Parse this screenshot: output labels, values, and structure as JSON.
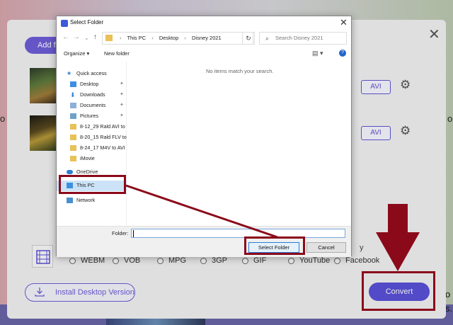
{
  "background": {
    "left_side_text": "o",
    "right_side_text": "o",
    "right_bottom_text_1": "o",
    "right_bottom_text_2": "s."
  },
  "panel": {
    "add_button_label": "Add f",
    "files": [
      {
        "format": "AVI"
      },
      {
        "format": "AVI"
      }
    ],
    "partial_label": "y",
    "formats": [
      "WEBM",
      "VOB",
      "MPG",
      "3GP",
      "GIF",
      "YouTube",
      "Facebook"
    ],
    "install_label": "Install Desktop Version",
    "convert_label": "Convert"
  },
  "dialog": {
    "title": "Select Folder",
    "breadcrumb": [
      "This PC",
      "Desktop",
      "Disney 2021"
    ],
    "search_placeholder": "Search Disney 2021",
    "organize_label": "Organize ▾",
    "new_folder_label": "New folder",
    "empty_message": "No items match your search.",
    "nav_items": [
      {
        "label": "Quick access",
        "icon": "star-icon"
      },
      {
        "label": "Desktop",
        "icon": "desktop-icon",
        "pinned": true
      },
      {
        "label": "Downloads",
        "icon": "download-icon",
        "pinned": true
      },
      {
        "label": "Documents",
        "icon": "document-icon",
        "pinned": true
      },
      {
        "label": "Pictures",
        "icon": "pictures-icon",
        "pinned": true
      },
      {
        "label": "8-12_29 Rald AVI to",
        "icon": "folder-icon"
      },
      {
        "label": "8-20_15 Rald FLV to",
        "icon": "folder-icon"
      },
      {
        "label": "8-24_17 M4V to AVI",
        "icon": "folder-icon"
      },
      {
        "label": "iMovie",
        "icon": "folder-icon"
      },
      {
        "label": "OneDrive",
        "icon": "cloud-icon"
      },
      {
        "label": "This PC",
        "icon": "computer-icon"
      },
      {
        "label": "Network",
        "icon": "network-icon"
      }
    ],
    "folder_label": "Folder:",
    "folder_value": "",
    "select_folder_label": "Select Folder",
    "cancel_label": "Cancel"
  },
  "colors": {
    "accent": "#5a51d8",
    "annotation": "#8b0a1a",
    "selection": "#cce3f7"
  }
}
